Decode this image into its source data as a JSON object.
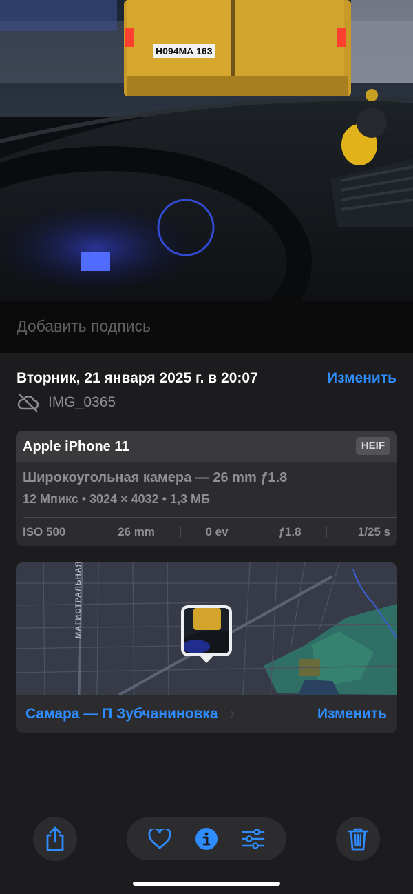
{
  "photo": {
    "plate_text": "Н094МА 163"
  },
  "caption": {
    "placeholder": "Добавить подпись"
  },
  "info": {
    "date": "Вторник, 21 января 2025 г. в 20:07",
    "edit_label": "Изменить",
    "file_name": "IMG_0365",
    "cloud_icon": "cloud-slash-icon"
  },
  "camera": {
    "model": "Apple iPhone 11",
    "format_badge": "HEIF",
    "lens": "Широкоугольная камера — 26 mm ƒ1.8",
    "specs": "12 Мпикс • 3024 × 4032 • 1,3 МБ",
    "exif": [
      "ISO 500",
      "26 mm",
      "0 ev",
      "ƒ1.8",
      "1/25 s"
    ]
  },
  "map": {
    "street_label": "МАГИСТРАЛЬНАЯ",
    "location": "Самара — П Зубчаниновка",
    "edit_label": "Изменить"
  },
  "toolbar": {
    "icons": [
      "share-icon",
      "heart-icon",
      "info-icon",
      "adjust-icon",
      "trash-icon"
    ]
  },
  "colors": {
    "accent": "#2f8cff",
    "sheet_bg": "#1c1c1e",
    "card_bg": "#2c2c2e",
    "secondary_text": "#8e8e93"
  }
}
